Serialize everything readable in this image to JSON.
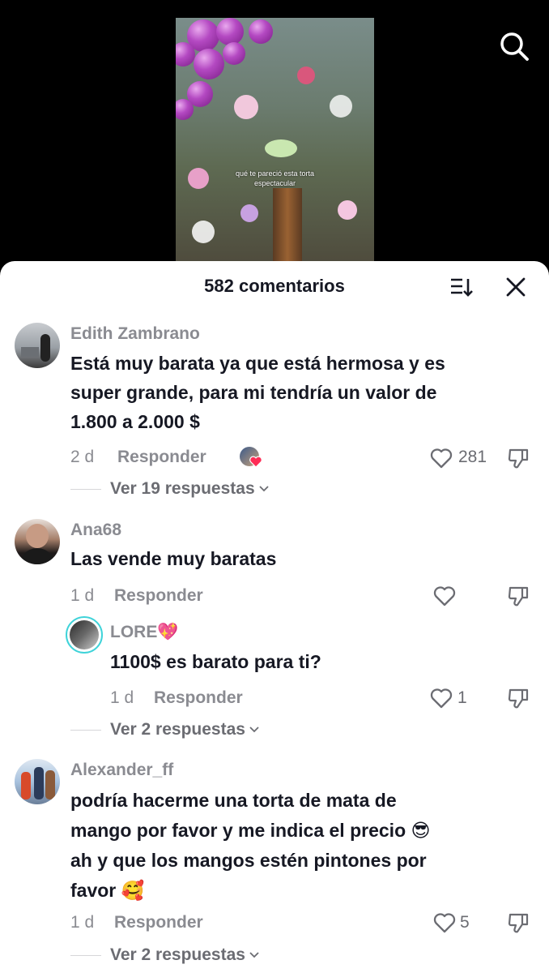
{
  "video": {
    "caption_line1": "qué te pareció esta torta",
    "caption_line2": "espectacular"
  },
  "sheet": {
    "title": "582 comentarios"
  },
  "comments": [
    {
      "username": "Edith Zambrano",
      "text_lines": [
        "Está muy barata ya que está hermosa y es",
        "super grande, para mi tendría un valor de",
        "1.800 a 2.000 $"
      ],
      "date": "2 d",
      "reply_label": "Responder",
      "likes": "281",
      "view_replies": "Ver 19 respuestas"
    },
    {
      "username": "Ana68",
      "text_lines": [
        "Las vende muy baratas"
      ],
      "date": "1 d",
      "reply_label": "Responder",
      "likes": ""
    },
    {
      "username": "LORE💖",
      "text_lines": [
        "1100$ es barato para ti?"
      ],
      "date": "1 d",
      "reply_label": "Responder",
      "likes": "1",
      "view_replies": "Ver 2 respuestas"
    },
    {
      "username": "Alexander_ff",
      "text_lines": [
        "podría hacerme una torta de mata de",
        "mango por favor y me indica el precio 😎",
        "ah y que los mangos estén pintones por",
        "favor 🥰"
      ],
      "date": "1 d",
      "reply_label": "Responder",
      "likes": "5",
      "view_replies": "Ver 2 respuestas"
    }
  ]
}
